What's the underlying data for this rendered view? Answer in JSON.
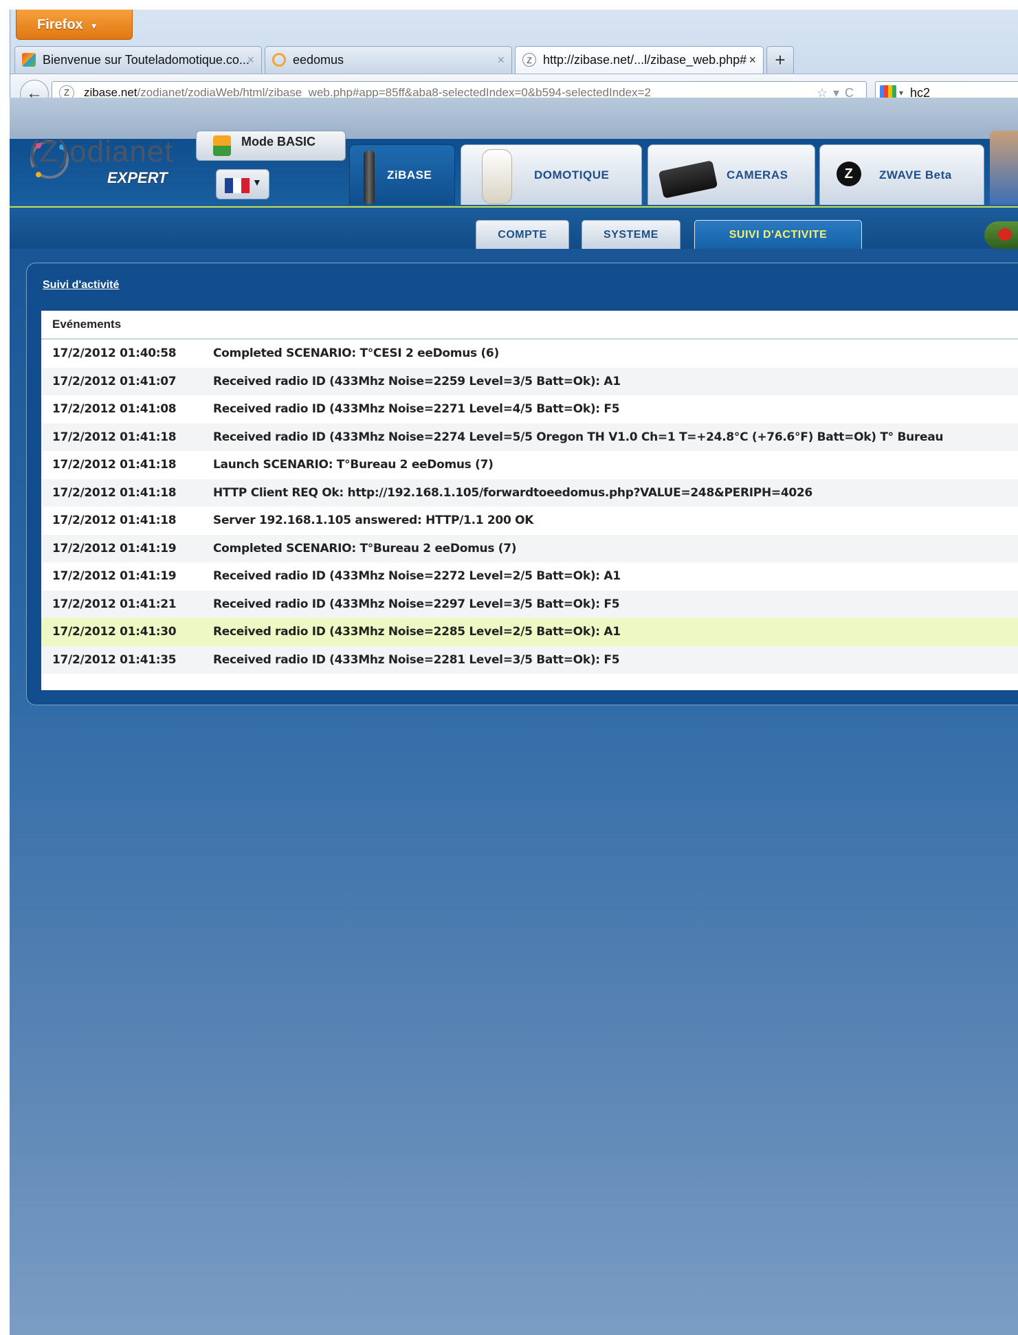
{
  "browser": {
    "menu_label": "Firefox",
    "tabs": [
      {
        "label": "Bienvenue sur Touteladomotique.co...",
        "icon": "joomla-icon",
        "active": false
      },
      {
        "label": "eedomus",
        "icon": "eedomus-icon",
        "active": false
      },
      {
        "label": "http://zibase.net/...l/zibase_web.php#",
        "icon": "zodianet-icon",
        "active": true
      }
    ],
    "new_tab_label": "+",
    "url_domain": "zibase.net",
    "url_path": "/zodianet/zodiaWeb/html/zibase_web.php#app=85ff&aba8-selectedIndex=0&b594-selectedIndex=2",
    "search_value": "hc2"
  },
  "app": {
    "logo_text": "(Z)odianet",
    "logo_sub": "EXPERT",
    "mode_button": "Mode BASIC",
    "main_tabs": [
      {
        "label": "ZiBASE",
        "icon": "zibase-antenna-icon",
        "active": true
      },
      {
        "label": "DOMOTIQUE",
        "icon": "plug-module-icon",
        "active": false
      },
      {
        "label": "CAMERAS",
        "icon": "camera-icon",
        "active": false
      },
      {
        "label": "ZWAVE Beta",
        "icon": "zwave-icon",
        "active": false
      }
    ],
    "sub_tabs": [
      {
        "label": "COMPTE",
        "active": false
      },
      {
        "label": "SYSTEME",
        "active": false
      },
      {
        "label": "SUIVI D'ACTIVITE",
        "active": true
      }
    ],
    "colors": {
      "accent": "#124d8e",
      "highlight_row": "#eef8c4",
      "active_subtab_text": "#f5f36b"
    }
  },
  "activity": {
    "title": "Suivi d'activité",
    "column_header": "Evénements",
    "events": [
      {
        "time": "17/2/2012 01:40:58",
        "message": "Completed SCENARIO:  T°CESI 2 eeDomus (6)"
      },
      {
        "time": "17/2/2012 01:41:07",
        "message": "Received radio ID (433Mhz Noise=2259 Level=3/5  Batt=Ok): A1"
      },
      {
        "time": "17/2/2012 01:41:08",
        "message": "Received radio ID (433Mhz Noise=2271 Level=4/5  Batt=Ok): F5"
      },
      {
        "time": "17/2/2012 01:41:18",
        "message": "Received radio ID (433Mhz Noise=2274 Level=5/5 Oregon TH V1.0 Ch=1 T=+24.8°C (+76.6°F)  Batt=Ok) T° Bureau"
      },
      {
        "time": "17/2/2012 01:41:18",
        "message": "Launch SCENARIO:  T°Bureau 2 eeDomus (7)"
      },
      {
        "time": "17/2/2012 01:41:18",
        "message": "HTTP Client REQ Ok: http://192.168.1.105/forwardtoeedomus.php?VALUE=248&PERIPH=4026"
      },
      {
        "time": "17/2/2012 01:41:18",
        "message": "Server 192.168.1.105 answered: HTTP/1.1 200 OK"
      },
      {
        "time": "17/2/2012 01:41:19",
        "message": "Completed SCENARIO:  T°Bureau 2 eeDomus (7)"
      },
      {
        "time": "17/2/2012 01:41:19",
        "message": "Received radio ID (433Mhz Noise=2272 Level=2/5  Batt=Ok): A1"
      },
      {
        "time": "17/2/2012 01:41:21",
        "message": "Received radio ID (433Mhz Noise=2297 Level=3/5  Batt=Ok): F5"
      },
      {
        "time": "17/2/2012 01:41:30",
        "message": "Received radio ID (433Mhz Noise=2285 Level=2/5  Batt=Ok): A1",
        "highlighted": true
      },
      {
        "time": "17/2/2012 01:41:35",
        "message": "Received radio ID (433Mhz Noise=2281 Level=3/5  Batt=Ok): F5"
      }
    ]
  }
}
